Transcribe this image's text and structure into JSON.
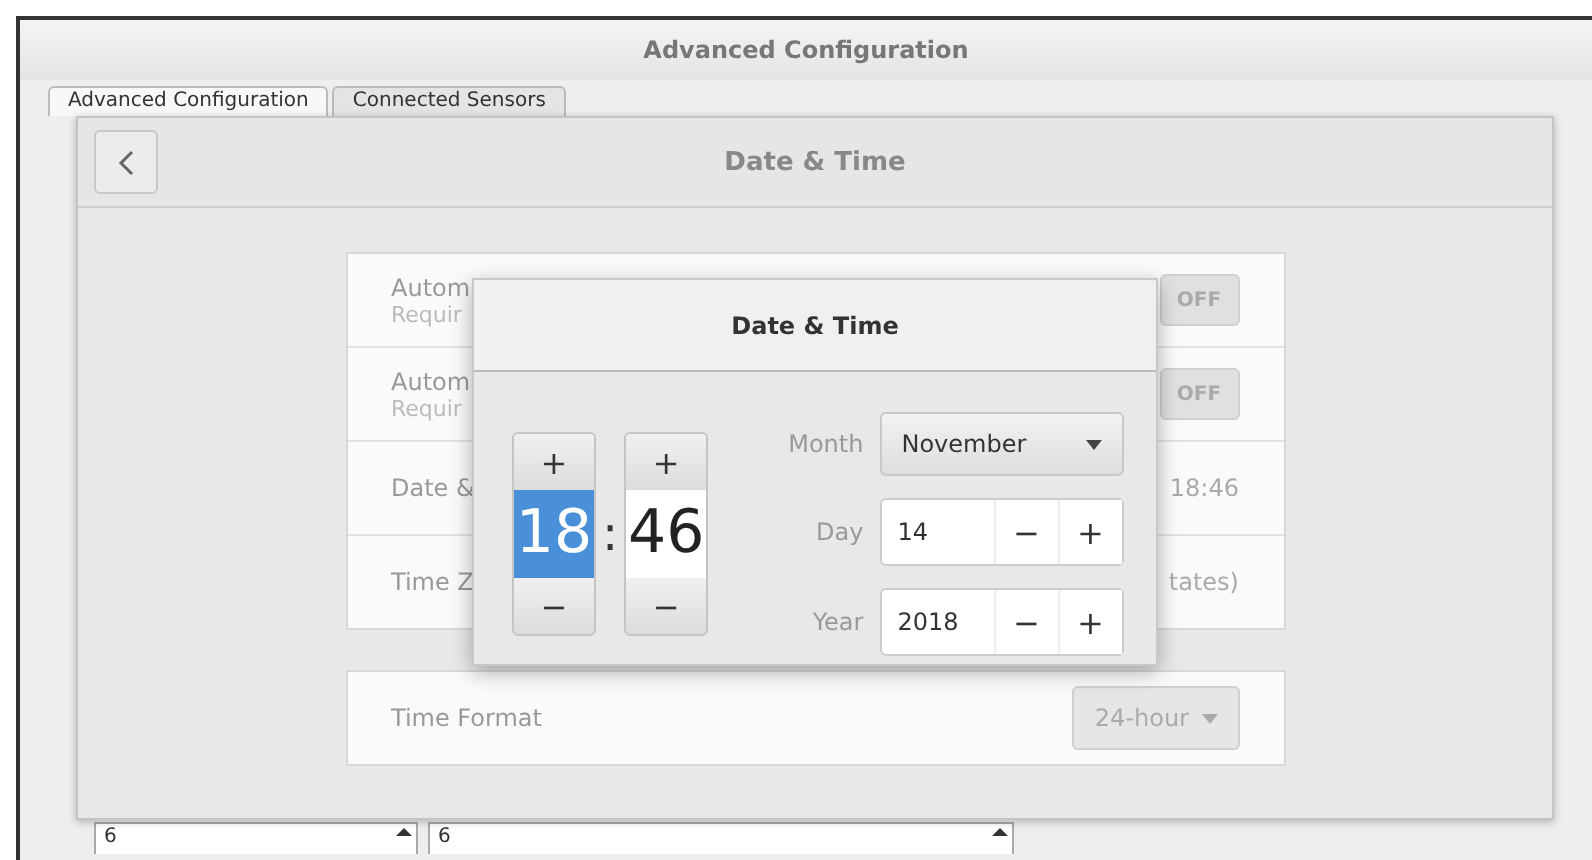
{
  "window": {
    "title": "Advanced Configuration"
  },
  "tabs": [
    {
      "label": "Advanced Configuration",
      "selected": true
    },
    {
      "label": "Connected Sensors",
      "selected": false
    }
  ],
  "panel": {
    "title": "Date & Time",
    "rows": [
      {
        "kind": "switch",
        "label": "Autom",
        "sublabel": "Requir",
        "state_text": "OFF",
        "on": false
      },
      {
        "kind": "switch",
        "label": "Autom",
        "sublabel": "Requir",
        "state_text": "OFF",
        "on": false
      },
      {
        "kind": "value",
        "label": "Date &",
        "value": "18:46"
      },
      {
        "kind": "value",
        "label": "Time Z",
        "value": "tates)"
      }
    ],
    "time_format": {
      "label": "Time Format",
      "value": "24-hour"
    }
  },
  "popup": {
    "title": "Date & Time",
    "separator": ":",
    "spinners": [
      {
        "value": "18",
        "selected": true,
        "plus": "+",
        "minus": "−"
      },
      {
        "value": "46",
        "selected": false,
        "plus": "+",
        "minus": "−"
      }
    ],
    "month": {
      "label": "Month",
      "value": "November"
    },
    "day": {
      "label": "Day",
      "value": "14",
      "minus": "−",
      "plus": "+"
    },
    "year": {
      "label": "Year",
      "value": "2018",
      "minus": "−",
      "plus": "+"
    }
  },
  "bottom_fields": [
    {
      "value": "6"
    },
    {
      "value": "6"
    }
  ]
}
